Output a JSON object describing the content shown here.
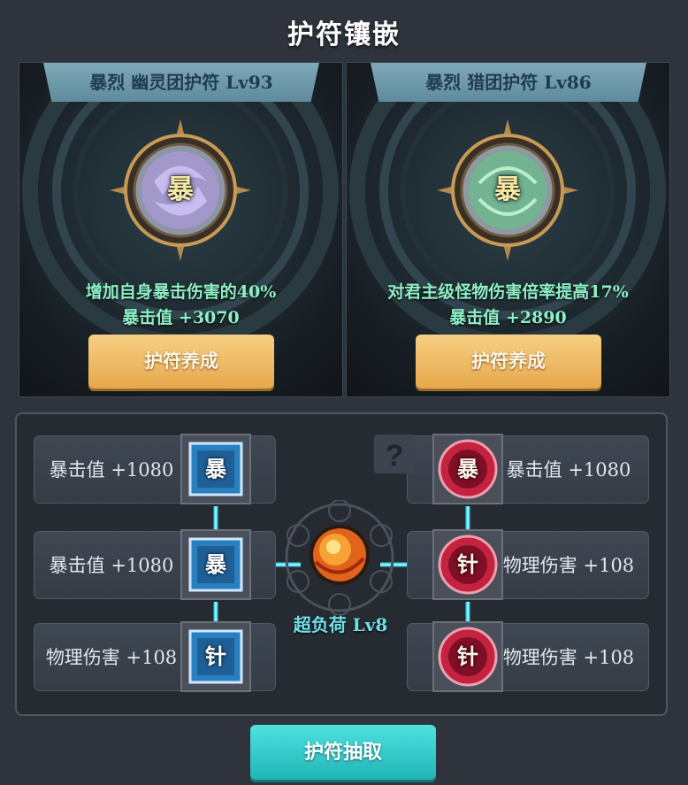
{
  "title": "护符镶嵌",
  "amulets": [
    {
      "name": "暴烈 幽灵团护符 Lv93",
      "emblem_char": "暴",
      "emblem_color": "#b9a7ef",
      "effect": "增加自身暴击伤害的40%",
      "stat": "暴击值 +3070",
      "button": "护符养成"
    },
    {
      "name": "暴烈 猎团护符 Lv86",
      "emblem_char": "暴",
      "emblem_color": "#63d28b",
      "effect": "对君主级怪物伤害倍率提高17%",
      "stat": "暴击值 +2890",
      "button": "护符养成"
    }
  ],
  "sockets": {
    "left": [
      {
        "stat": "暴击值 +1080",
        "gem": "暴",
        "gem_style": "blue-square"
      },
      {
        "stat": "暴击值 +1080",
        "gem": "暴",
        "gem_style": "blue-square"
      },
      {
        "stat": "物理伤害 +108",
        "gem": "针",
        "gem_style": "blue-square"
      }
    ],
    "right": [
      {
        "stat": "暴击值 +1080",
        "gem": "暴",
        "gem_style": "red-round"
      },
      {
        "stat": "物理伤害 +108",
        "gem": "针",
        "gem_style": "red-round"
      },
      {
        "stat": "物理伤害 +108",
        "gem": "针",
        "gem_style": "red-round"
      }
    ],
    "center_label": "超负荷 Lv8",
    "help_icon": "question-mark-icon"
  },
  "draw_button": "护符抽取",
  "colors": {
    "gold_button": "#eab45a",
    "cyan_button": "#33cbcb",
    "link_glow": "#39e6ff",
    "effect_text": "#8ef0c6"
  }
}
